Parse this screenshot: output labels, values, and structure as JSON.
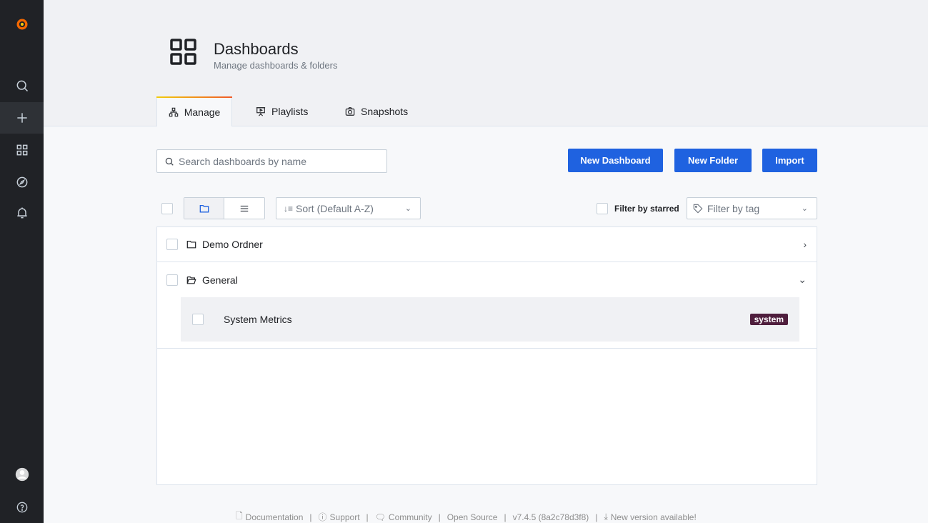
{
  "header": {
    "title": "Dashboards",
    "subtitle": "Manage dashboards & folders",
    "tabs": [
      {
        "label": "Manage",
        "icon": "sitemap-icon"
      },
      {
        "label": "Playlists",
        "icon": "presentation-icon"
      },
      {
        "label": "Snapshots",
        "icon": "camera-icon"
      }
    ]
  },
  "toolbar": {
    "search_placeholder": "Search dashboards by name",
    "new_dashboard": "New Dashboard",
    "new_folder": "New Folder",
    "import": "Import",
    "sort_label": "Sort (Default A-Z)",
    "filter_starred": "Filter by starred",
    "filter_tag_placeholder": "Filter by tag"
  },
  "list": {
    "folders": [
      {
        "name": "Demo Ordner",
        "expanded": false
      },
      {
        "name": "General",
        "expanded": true
      }
    ],
    "dashboards": [
      {
        "name": "System Metrics",
        "tag": "system"
      }
    ]
  },
  "footer": {
    "documentation": "Documentation",
    "support": "Support",
    "community": "Community",
    "open_source": "Open Source",
    "version": "v7.4.5 (8a2c78d3f8)",
    "new_version": "New version available!"
  },
  "colors": {
    "primary_button": "#1f62e0",
    "sidebar": "#202226",
    "tag_system": "#4f1e3d"
  }
}
